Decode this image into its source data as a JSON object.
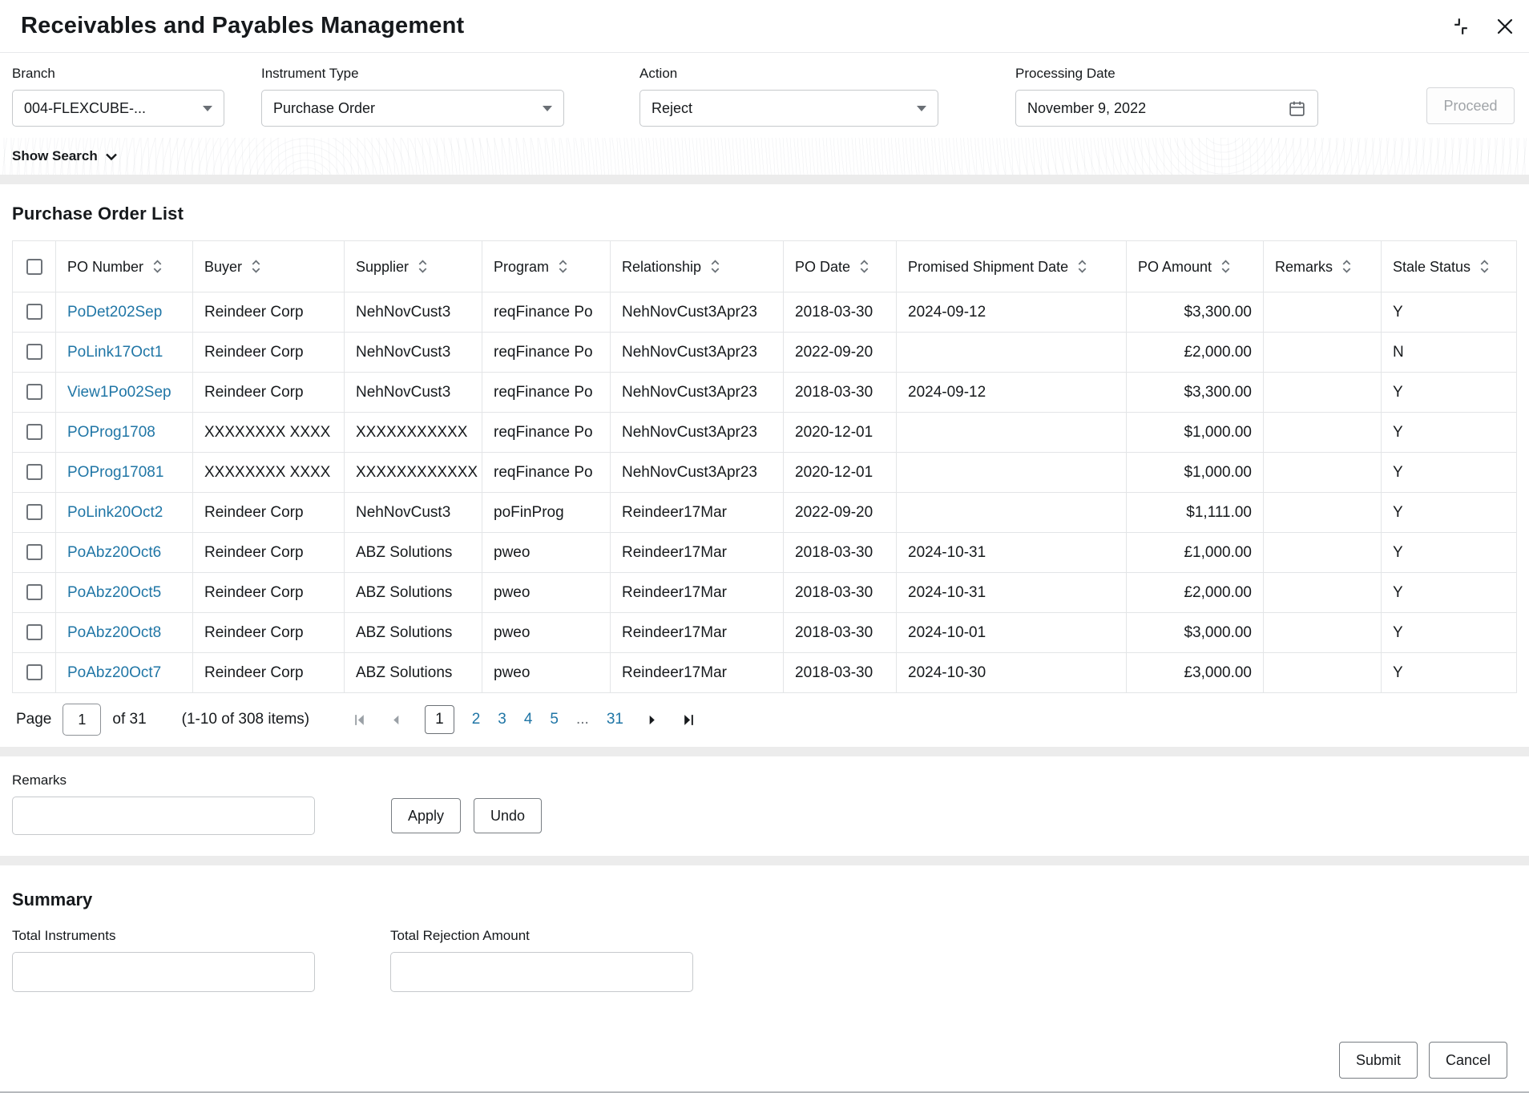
{
  "window": {
    "title": "Receivables and Payables Management"
  },
  "filters": {
    "branch": {
      "label": "Branch",
      "value": "004-FLEXCUBE-..."
    },
    "instrument_type": {
      "label": "Instrument Type",
      "value": "Purchase Order"
    },
    "action": {
      "label": "Action",
      "value": "Reject"
    },
    "processing_date": {
      "label": "Processing Date",
      "value": "November 9, 2022"
    },
    "proceed_label": "Proceed",
    "show_search_label": "Show Search"
  },
  "table": {
    "title": "Purchase Order List",
    "columns": [
      "PO Number",
      "Buyer",
      "Supplier",
      "Program",
      "Relationship",
      "PO Date",
      "Promised Shipment Date",
      "PO Amount",
      "Remarks",
      "Stale Status"
    ],
    "rows": [
      {
        "po_number": "PoDet202Sep",
        "buyer": "Reindeer Corp",
        "supplier": "NehNovCust3",
        "program": "reqFinance Po",
        "relationship": "NehNovCust3Apr23",
        "po_date": "2018-03-30",
        "promised_shipment_date": "2024-09-12",
        "po_amount": "$3,300.00",
        "remarks": "",
        "stale_status": "Y"
      },
      {
        "po_number": "PoLink17Oct1",
        "buyer": "Reindeer Corp",
        "supplier": "NehNovCust3",
        "program": "reqFinance Po",
        "relationship": "NehNovCust3Apr23",
        "po_date": "2022-09-20",
        "promised_shipment_date": "",
        "po_amount": "£2,000.00",
        "remarks": "",
        "stale_status": "N"
      },
      {
        "po_number": "View1Po02Sep",
        "buyer": "Reindeer Corp",
        "supplier": "NehNovCust3",
        "program": "reqFinance Po",
        "relationship": "NehNovCust3Apr23",
        "po_date": "2018-03-30",
        "promised_shipment_date": "2024-09-12",
        "po_amount": "$3,300.00",
        "remarks": "",
        "stale_status": "Y"
      },
      {
        "po_number": "POProg1708",
        "buyer": "XXXXXXXX XXXX",
        "supplier": "XXXXXXXXXXX",
        "program": "reqFinance Po",
        "relationship": "NehNovCust3Apr23",
        "po_date": "2020-12-01",
        "promised_shipment_date": "",
        "po_amount": "$1,000.00",
        "remarks": "",
        "stale_status": "Y"
      },
      {
        "po_number": "POProg17081",
        "buyer": "XXXXXXXX XXXX",
        "supplier": "XXXXXXXXXXXX",
        "program": "reqFinance Po",
        "relationship": "NehNovCust3Apr23",
        "po_date": "2020-12-01",
        "promised_shipment_date": "",
        "po_amount": "$1,000.00",
        "remarks": "",
        "stale_status": "Y"
      },
      {
        "po_number": "PoLink20Oct2",
        "buyer": "Reindeer Corp",
        "supplier": "NehNovCust3",
        "program": "poFinProg",
        "relationship": "Reindeer17Mar",
        "po_date": "2022-09-20",
        "promised_shipment_date": "",
        "po_amount": "$1,111.00",
        "remarks": "",
        "stale_status": "Y"
      },
      {
        "po_number": "PoAbz20Oct6",
        "buyer": "Reindeer Corp",
        "supplier": "ABZ Solutions",
        "program": "pweo",
        "relationship": "Reindeer17Mar",
        "po_date": "2018-03-30",
        "promised_shipment_date": "2024-10-31",
        "po_amount": "£1,000.00",
        "remarks": "",
        "stale_status": "Y"
      },
      {
        "po_number": "PoAbz20Oct5",
        "buyer": "Reindeer Corp",
        "supplier": "ABZ Solutions",
        "program": "pweo",
        "relationship": "Reindeer17Mar",
        "po_date": "2018-03-30",
        "promised_shipment_date": "2024-10-31",
        "po_amount": "£2,000.00",
        "remarks": "",
        "stale_status": "Y"
      },
      {
        "po_number": "PoAbz20Oct8",
        "buyer": "Reindeer Corp",
        "supplier": "ABZ Solutions",
        "program": "pweo",
        "relationship": "Reindeer17Mar",
        "po_date": "2018-03-30",
        "promised_shipment_date": "2024-10-01",
        "po_amount": "$3,000.00",
        "remarks": "",
        "stale_status": "Y"
      },
      {
        "po_number": "PoAbz20Oct7",
        "buyer": "Reindeer Corp",
        "supplier": "ABZ Solutions",
        "program": "pweo",
        "relationship": "Reindeer17Mar",
        "po_date": "2018-03-30",
        "promised_shipment_date": "2024-10-30",
        "po_amount": "£3,000.00",
        "remarks": "",
        "stale_status": "Y"
      }
    ]
  },
  "pagination": {
    "page_label": "Page",
    "current_page": "1",
    "of_label": "of 31",
    "items_label": "(1-10 of 308 items)",
    "pages": [
      "1",
      "2",
      "3",
      "4",
      "5",
      "...",
      "31"
    ]
  },
  "remarks": {
    "label": "Remarks",
    "value": "",
    "apply_label": "Apply",
    "undo_label": "Undo"
  },
  "summary": {
    "title": "Summary",
    "total_instruments_label": "Total Instruments",
    "total_instruments_value": "",
    "total_rejection_amount_label": "Total Rejection Amount",
    "total_rejection_amount_value": ""
  },
  "footer": {
    "submit_label": "Submit",
    "cancel_label": "Cancel"
  },
  "colors": {
    "link": "#2076a6",
    "disabled_text": "#a0a4a8",
    "border": "#e3e5e7"
  }
}
